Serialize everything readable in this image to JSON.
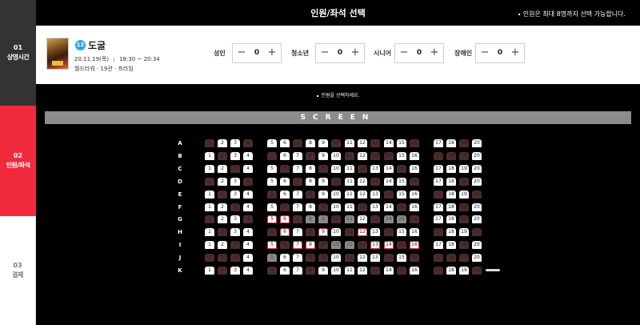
{
  "sidebar": {
    "steps": [
      {
        "num": "01",
        "label": "상영시간"
      },
      {
        "num": "02",
        "label": "인원/좌석"
      },
      {
        "num": "03",
        "label": "결제"
      }
    ]
  },
  "header": {
    "title": "인원/좌석 선택",
    "notice": "인원은 최대 8명까지 선택 가능합니다."
  },
  "movie": {
    "age_rating": "12",
    "title": "도굴",
    "date": "20.11.19(목)",
    "time": "18:30 ~ 20:34",
    "venue": "월드타워 · 19관 · 프라임"
  },
  "counters": [
    {
      "label": "성인",
      "value": "0",
      "minus": "−",
      "plus": "+"
    },
    {
      "label": "청소년",
      "value": "0",
      "minus": "−",
      "plus": "+"
    },
    {
      "label": "시니어",
      "value": "0",
      "minus": "−",
      "plus": "+"
    },
    {
      "label": "장애인",
      "value": "0",
      "minus": "−",
      "plus": "+"
    }
  ],
  "guide": "인원을 선택하세요.",
  "screen_label": "SCREEN",
  "colors": {
    "accent": "#f02a3c",
    "sold_seat": "#4a2d2b",
    "screen": "#8c8c8c",
    "badge": "#2ea7e0"
  },
  "seat_rows": [
    {
      "row": "A",
      "seats": [
        "s",
        "a",
        "a",
        "s",
        "a",
        "a",
        "s",
        "a",
        "a",
        "s",
        "a",
        "a",
        "s",
        "a",
        "a",
        "s",
        "a",
        "a",
        "s",
        "a"
      ]
    },
    {
      "row": "B",
      "seats": [
        "a",
        "s",
        "a",
        "a",
        "s",
        "a",
        "a",
        "s",
        "a",
        "a",
        "s",
        "a",
        "s",
        "s",
        "a",
        "a",
        "s",
        "s",
        "s",
        "a"
      ]
    },
    {
      "row": "C",
      "seats": [
        "a",
        "a",
        "s",
        "a",
        "a",
        "s",
        "a",
        "a",
        "s",
        "a",
        "a",
        "s",
        "a",
        "a",
        "s",
        "a",
        "a",
        "a",
        "a",
        "a"
      ]
    },
    {
      "row": "D",
      "seats": [
        "s",
        "a",
        "a",
        "s",
        "a",
        "a",
        "s",
        "a",
        "a",
        "s",
        "a",
        "a",
        "s",
        "a",
        "a",
        "s",
        "a",
        "a",
        "s",
        "a"
      ]
    },
    {
      "row": "E",
      "seats": [
        "a",
        "s",
        "a",
        "a",
        "s",
        "a",
        "a",
        "s",
        "a",
        "a",
        "a",
        "a",
        "a",
        "s",
        "a",
        "a",
        "s",
        "a",
        "a",
        "s"
      ]
    },
    {
      "row": "F",
      "seats": [
        "a",
        "a",
        "s",
        "a",
        "a",
        "s",
        "a",
        "a",
        "s",
        "a",
        "a",
        "s",
        "a",
        "a",
        "s",
        "a",
        "a",
        "a",
        "s",
        "a"
      ]
    },
    {
      "row": "G",
      "seats": [
        "s",
        "a",
        "a",
        "s",
        "r",
        "r",
        "s",
        "g",
        "g",
        "s",
        "g",
        "a",
        "s",
        "g",
        "g",
        "s",
        "a",
        "a",
        "s",
        "a"
      ]
    },
    {
      "row": "H",
      "seats": [
        "a",
        "s",
        "a",
        "a",
        "s",
        "r",
        "a",
        "s",
        "r",
        "a",
        "s",
        "r",
        "a",
        "s",
        "a",
        "a",
        "s",
        "a",
        "a",
        "s"
      ]
    },
    {
      "row": "I",
      "seats": [
        "a",
        "a",
        "s",
        "a",
        "r",
        "s",
        "r",
        "r",
        "s",
        "g",
        "g",
        "s",
        "r",
        "r",
        "s",
        "r",
        "a",
        "a",
        "s",
        "a"
      ]
    },
    {
      "row": "J",
      "seats": [
        "s",
        "s",
        "s",
        "a",
        "g",
        "a",
        "a",
        "s",
        "s",
        "a",
        "s",
        "a",
        "a",
        "s",
        "a",
        "s",
        "s",
        "s",
        "s",
        "a"
      ]
    },
    {
      "row": "K",
      "seats": [
        "a",
        "s",
        "a",
        "a",
        "s",
        "a",
        "a",
        "s",
        "a",
        "a",
        "a",
        "a",
        "s",
        "a",
        "s",
        "a",
        "s",
        "a",
        "a",
        "s"
      ]
    }
  ]
}
